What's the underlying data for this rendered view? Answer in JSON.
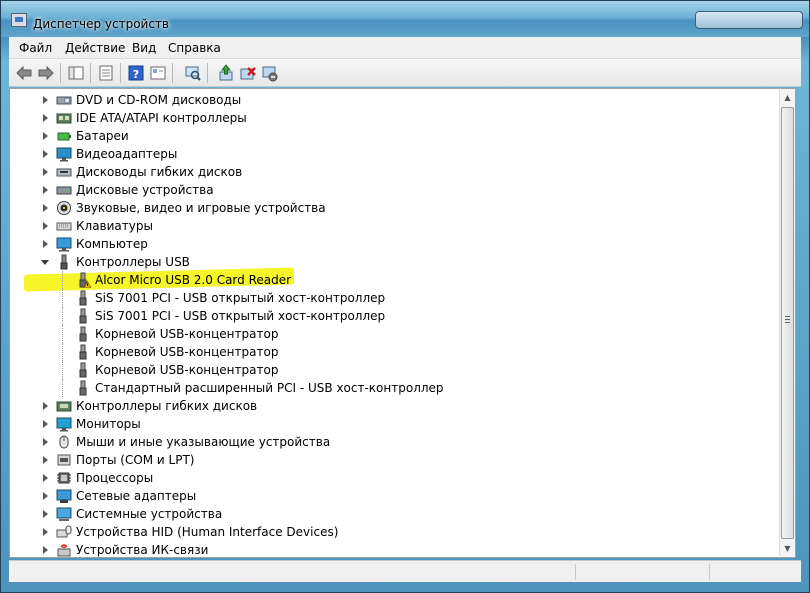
{
  "window": {
    "title": "Диспетчер устройств"
  },
  "menu": {
    "items": [
      "Файл",
      "Действие",
      "Вид",
      "Справка"
    ]
  },
  "toolbar": {
    "buttons": [
      "back-icon",
      "forward-icon",
      "show-hide-tree-icon",
      "properties-icon",
      "help-icon",
      "view-icon",
      "scan-hardware-icon",
      "update-driver-icon",
      "uninstall-icon",
      "disable-icon"
    ]
  },
  "tree": {
    "items": [
      {
        "label": "DVD и CD-ROM дисководы",
        "icon": "dvd-drive-icon",
        "expanded": false
      },
      {
        "label": "IDE ATA/ATAPI контроллеры",
        "icon": "ide-controller-icon",
        "expanded": false
      },
      {
        "label": "Батареи",
        "icon": "battery-icon",
        "expanded": false
      },
      {
        "label": "Видеоадаптеры",
        "icon": "display-adapter-icon",
        "expanded": false
      },
      {
        "label": "Дисководы гибких дисков",
        "icon": "floppy-drive-icon",
        "expanded": false
      },
      {
        "label": "Дисковые устройства",
        "icon": "disk-drive-icon",
        "expanded": false
      },
      {
        "label": "Звуковые, видео и игровые устройства",
        "icon": "sound-icon",
        "expanded": false
      },
      {
        "label": "Клавиатуры",
        "icon": "keyboard-icon",
        "expanded": false
      },
      {
        "label": "Компьютер",
        "icon": "computer-icon",
        "expanded": false
      },
      {
        "label": "Контроллеры USB",
        "icon": "usb-icon",
        "expanded": true
      },
      {
        "label": "Alcor Micro USB 2.0 Card Reader",
        "icon": "usb-warning-icon",
        "child": true,
        "warning": true
      },
      {
        "label": "SiS 7001 PCI - USB открытый хост-контроллер",
        "icon": "usb-device-icon",
        "child": true
      },
      {
        "label": "SiS 7001 PCI - USB открытый хост-контроллер",
        "icon": "usb-device-icon",
        "child": true
      },
      {
        "label": "Корневой USB-концентратор",
        "icon": "usb-device-icon",
        "child": true
      },
      {
        "label": "Корневой USB-концентратор",
        "icon": "usb-device-icon",
        "child": true
      },
      {
        "label": "Корневой USB-концентратор",
        "icon": "usb-device-icon",
        "child": true
      },
      {
        "label": "Стандартный расширенный PCI - USB хост-контроллер",
        "icon": "usb-device-icon",
        "child": true
      },
      {
        "label": "Контроллеры гибких дисков",
        "icon": "floppy-controller-icon",
        "expanded": false
      },
      {
        "label": "Мониторы",
        "icon": "monitor-icon",
        "expanded": false
      },
      {
        "label": "Мыши и иные указывающие устройства",
        "icon": "mouse-icon",
        "expanded": false
      },
      {
        "label": "Порты (COM и LPT)",
        "icon": "port-icon",
        "expanded": false
      },
      {
        "label": "Процессоры",
        "icon": "processor-icon",
        "expanded": false
      },
      {
        "label": "Сетевые адаптеры",
        "icon": "network-adapter-icon",
        "expanded": false
      },
      {
        "label": "Системные устройства",
        "icon": "system-device-icon",
        "expanded": false
      },
      {
        "label": "Устройства HID (Human Interface Devices)",
        "icon": "hid-icon",
        "expanded": false
      },
      {
        "label": "Устройства ИК-связи",
        "icon": "infrared-icon",
        "expanded": false
      }
    ]
  },
  "colors": {
    "highlight": "#f5f52a",
    "warning": "#f2c200"
  }
}
